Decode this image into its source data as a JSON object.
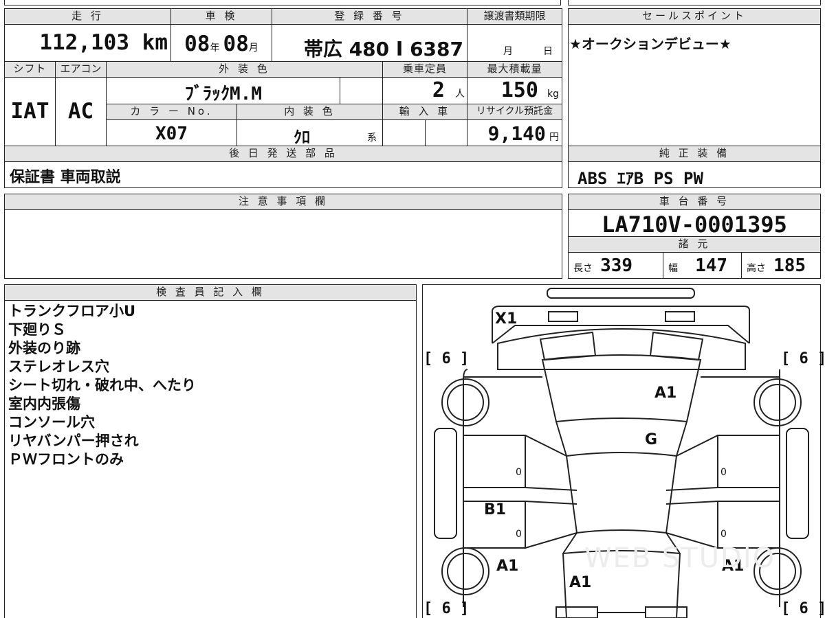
{
  "headers": {
    "mileage": "走 行",
    "inspection": "車 検",
    "registration": "登 録 番 号",
    "doc_deadline": "譲渡書類期限",
    "sales_point": "セールスポイント",
    "shift": "シフト",
    "aircon": "エアコン",
    "exterior_color": "外 装 色",
    "capacity": "乗車定員",
    "max_load": "最大積載量",
    "color_no": "カ ラ ー No.",
    "interior_color": "内 装 色",
    "import": "輸 入 車",
    "recycle": "リサイクル預託金",
    "later_parts": "後 日 発 送 部 品",
    "genuine_equipment": "純 正 装 備",
    "caution": "注 意 事 項 欄",
    "chassis_no": "車 台 番 号",
    "specs": "諸 元",
    "inspector": "検 査 員 記 入 欄"
  },
  "values": {
    "mileage": "112,103 km",
    "inspection_year": "08",
    "inspection_year_unit": "年",
    "inspection_month": "08",
    "inspection_month_unit": "月",
    "registration": "帯広 480 Ι 6387",
    "deadline_month": "月",
    "deadline_day": "日",
    "sales_point": "★オークションデビュー★",
    "shift": "IAT",
    "aircon": "AC",
    "exterior_color": "ﾌﾞﾗｯｸM.M",
    "capacity": "2",
    "capacity_unit": "人",
    "max_load": "150",
    "max_load_unit": "kg",
    "color_no": "X07",
    "interior_color": "ｸﾛ",
    "interior_suffix": "系",
    "recycle": "9,140",
    "recycle_unit": "円",
    "later_parts": "保証書 車両取説",
    "genuine_equipment": "ABS ｴｱB PS PW",
    "chassis_no": "LA710V-0001395",
    "length_label": "長さ",
    "length": "339",
    "width_label": "幅",
    "width": "147",
    "height_label": "高さ",
    "height": "185"
  },
  "inspector_notes": [
    "トランクフロア小U",
    "下廻りＳ",
    "外装のり跡",
    "ステレオレス穴",
    "シート切れ・破れ中、へたり",
    "室内内張傷",
    "コンソール穴",
    "リヤバンパー押され",
    "ＰＷフロントのみ"
  ],
  "diagram": {
    "tire_tl": "[ 6 ]",
    "tire_tr": "[ 6 ]",
    "tire_bl": "[ 6 ]",
    "tire_br": "[ 6 ]",
    "rear": "X1",
    "roof": "A1",
    "rear_glass": "G",
    "left_panel_upper": "0",
    "left_panel_lower": "0",
    "right_panel_upper": "0",
    "right_panel_lower": "0",
    "left_door": "B1",
    "left_fender": "A1",
    "right_fender": "A1",
    "hood": "A1",
    "watermark": "WEB STUDIO"
  }
}
